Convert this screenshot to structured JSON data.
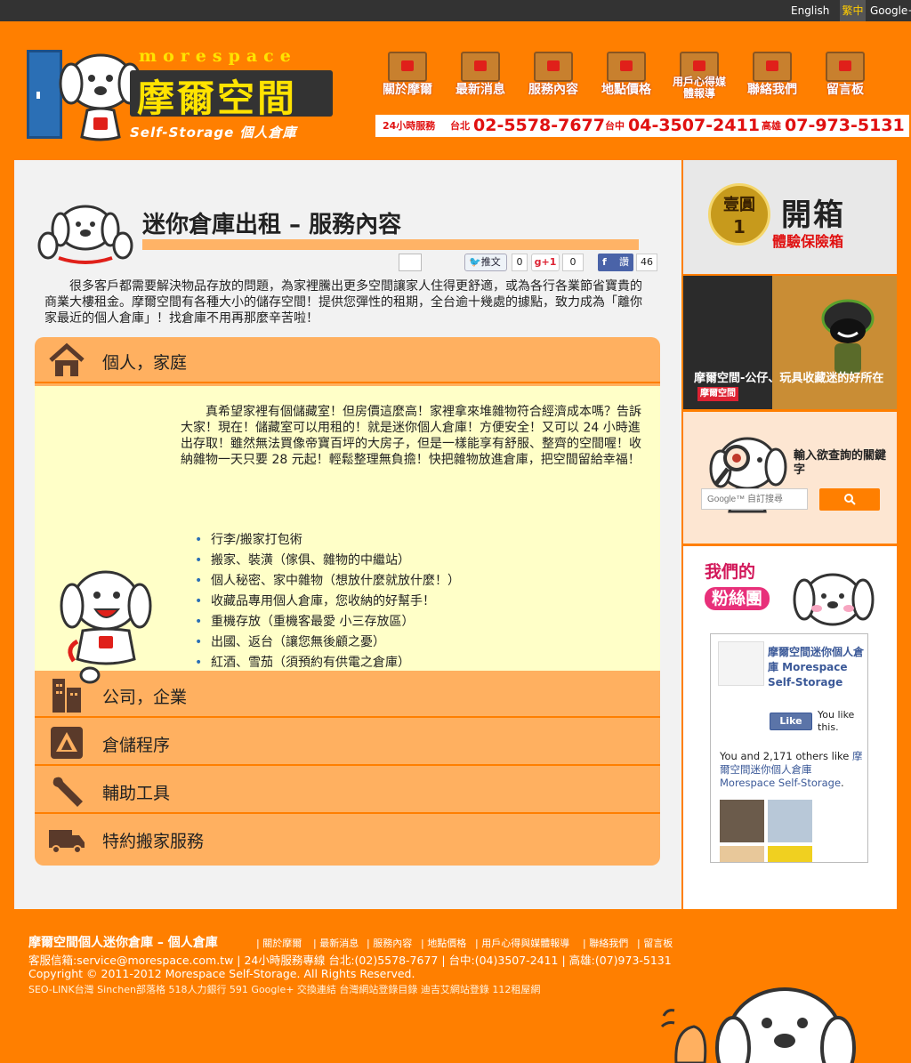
{
  "topbar": {
    "english": "English",
    "traditional": "繁中",
    "googleplus": "Google+"
  },
  "logo": {
    "en_name": "morespace",
    "zh_name": "摩爾空間",
    "tagline": "Self-Storage 個人倉庫"
  },
  "nav": [
    {
      "label": "關於摩爾"
    },
    {
      "label": "最新消息"
    },
    {
      "label": "服務內容"
    },
    {
      "label": "地點價格"
    },
    {
      "label": "用戶心得媒體報導"
    },
    {
      "label": "聯絡我們"
    },
    {
      "label": "留言板"
    }
  ],
  "phones": {
    "prefix": "24小時服務",
    "taipei_label": "台北",
    "taipei": "02-5578-7677",
    "taichung_label": "台中",
    "taichung": "04-3507-2411",
    "kaohsiung_label": "高雄",
    "kaohsiung": "07-973-5131"
  },
  "page": {
    "title": "迷你倉庫出租 – 服務內容",
    "intro": "很多客戶都需要解決物品存放的問題，為家裡騰出更多空間讓家人住得更舒適，或為各行各業節省寶貴的商業大樓租金。摩爾空間有各種大小的儲存空間！提供您彈性的租期，全台逾十幾處的據點，致力成為「離你家最近的個人倉庫」！找倉庫不用再那麼辛苦啦！"
  },
  "share": {
    "tweet_label": "推文",
    "tweet_count": "0",
    "gplus_label": "g+1",
    "gplus_count": "0",
    "fb_label": "讚",
    "fb_count": "46"
  },
  "sections": [
    {
      "label": "個人，家庭"
    },
    {
      "label": "公司，企業"
    },
    {
      "label": "倉儲程序"
    },
    {
      "label": "輔助工具"
    },
    {
      "label": "特約搬家服務"
    }
  ],
  "personal": {
    "text": "真希望家裡有個儲藏室！但房價這麼高！家裡拿來堆雜物符合經濟成本嗎？告訴大家！現在！儲藏室可以用租的！就是迷你個人倉庫！方便安全！又可以 24 小時進出存取！雖然無法買像帝寶百坪的大房子，但是一樣能享有舒服、整齊的空間喔！收納雜物一天只要 28 元起！輕鬆整理無負擔！快把雜物放進倉庫，把空間留給幸福！",
    "items": [
      "行李/搬家打包術",
      "搬家、裝潢（傢俱、雜物的中繼站）",
      "個人秘密、家中雜物（想放什麼就放什麼！）",
      "收藏品專用個人倉庫，您收納的好幫手！",
      "重機存放（重機客最愛 小三存放區）",
      "出國、返台（讓您無後顧之憂）",
      "紅酒、雪茄（須預約有供電之倉庫）"
    ]
  },
  "sidebar": {
    "promo1": {
      "badge_top": "壹圓",
      "badge_num": "1",
      "big": "開箱",
      "sub": "體驗保險箱"
    },
    "promo2": {
      "caption": "摩爾空間-公仔、玩具收藏迷的好所在",
      "stamp": "摩爾空間"
    },
    "search": {
      "hint": "輸入欲查詢的關鍵字",
      "placeholder": "Google™ 自訂搜尋"
    },
    "fans": {
      "title1": "我們的",
      "title2": "粉絲團"
    },
    "fb": {
      "page_name": "摩爾空間迷你個人倉庫 Morespace Self-Storage",
      "like": "Like",
      "you_like": "You like this.",
      "count_prefix": "You and 2,171 others like ",
      "count_link": "摩爾空間迷你個人倉庫 Morespace Self-Storage",
      "count_suffix": "."
    }
  },
  "footer": {
    "title": "摩爾空間個人迷你倉庫 – 個人倉庫",
    "nav": [
      "關於摩爾",
      "最新消息",
      "服務內容",
      "地點價格",
      "用戶心得與媒體報導",
      "聯絡我們",
      "留言板"
    ],
    "line2": "客服信箱:service@morespace.com.tw | 24小時服務專線 台北:(02)5578-7677 | 台中:(04)3507-2411 | 高雄:(07)973-5131",
    "line3": "Copyright © 2011-2012 Morespace Self-Storage. All Rights Reserved.",
    "line4": "SEO-LINK台灣 Sinchen部落格 518人力銀行 591 Google+ 交換連結 台灣網站登錄目錄 迪吉艾網站登錄 112租屋網"
  },
  "colors": {
    "brand_orange": "#ff7f00",
    "accent_yellow": "#ffe300",
    "phone_red": "#e01010",
    "body_cream": "#ffffc8"
  }
}
